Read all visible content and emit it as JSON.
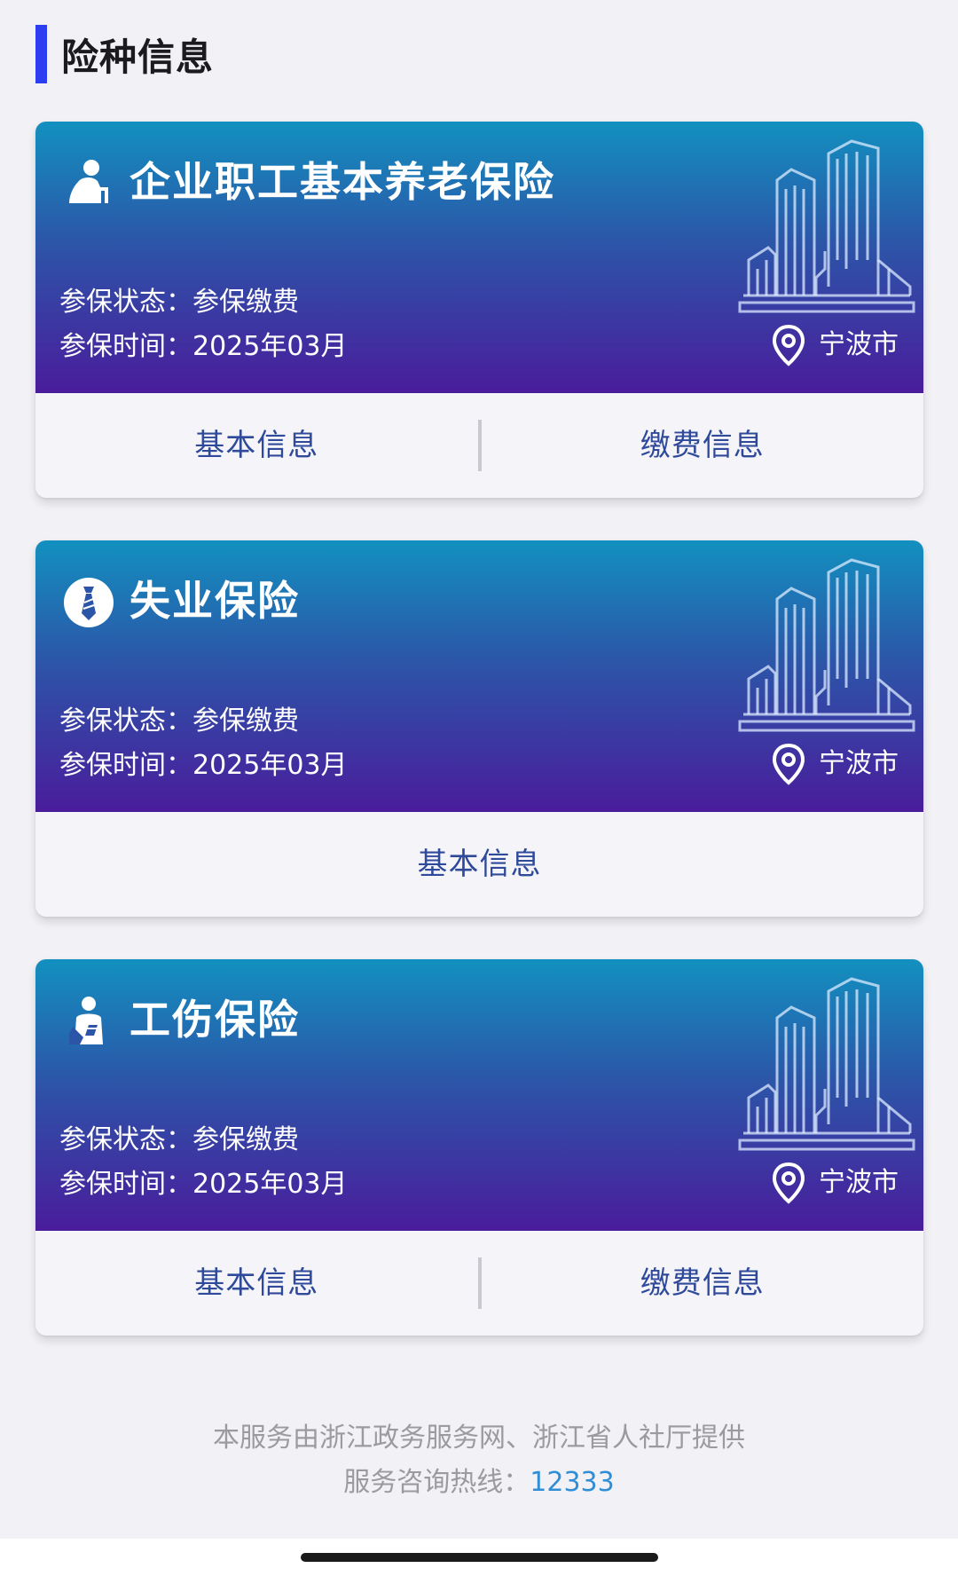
{
  "section": {
    "title": "险种信息"
  },
  "cards": [
    {
      "icon": "elder-person-icon",
      "title": "企业职工基本养老保险",
      "status": "参保状态：参保缴费",
      "time": "参保时间：2025年03月",
      "location": "宁波市",
      "actions": [
        "基本信息",
        "缴费信息"
      ]
    },
    {
      "icon": "tie-icon",
      "title": "失业保险",
      "status": "参保状态：参保缴费",
      "time": "参保时间：2025年03月",
      "location": "宁波市",
      "actions": [
        "基本信息"
      ]
    },
    {
      "icon": "injured-person-icon",
      "title": "工伤保险",
      "status": "参保状态：参保缴费",
      "time": "参保时间：2025年03月",
      "location": "宁波市",
      "actions": [
        "基本信息",
        "缴费信息"
      ]
    }
  ],
  "footer": {
    "provider": "本服务由浙江政务服务网、浙江省人社厅提供",
    "hotline_label": "服务咨询热线：",
    "hotline_number": "12333"
  },
  "colors": {
    "accent_bar": "#2d3df0",
    "gradient_top": "#1290bf",
    "gradient_bottom": "#4a1c9c",
    "action_text": "#2f4a9a",
    "hotline": "#2f8ed6"
  }
}
